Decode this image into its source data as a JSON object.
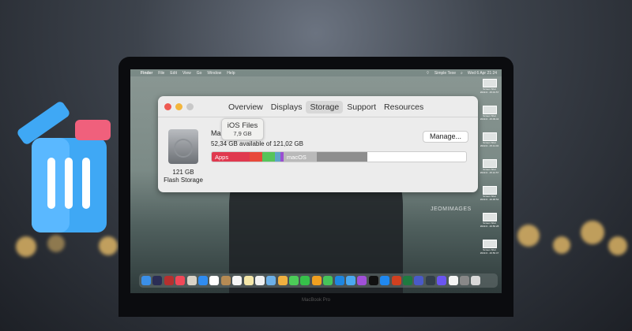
{
  "menubar": {
    "items": [
      "Finder",
      "File",
      "Edit",
      "View",
      "Go",
      "Window",
      "Help"
    ],
    "user": "Simple Texe",
    "clock": "Wed 6 Apr 21:24"
  },
  "window": {
    "tabs": [
      "Overview",
      "Displays",
      "Storage",
      "Support",
      "Resources"
    ],
    "active_tab": "Storage",
    "disk": {
      "size": "121 GB",
      "type": "Flash Storage"
    },
    "volume_name": "Ma",
    "available": "52,34 GB available of 121,02 GB",
    "tooltip": {
      "title": "iOS Files",
      "size": "7,9 GB"
    },
    "manage_label": "Manage...",
    "segments": [
      {
        "label": "Apps",
        "color": "#e0394f",
        "pct": 15
      },
      {
        "label": "",
        "color": "#e8493a",
        "pct": 5
      },
      {
        "label": "",
        "color": "#57c45a",
        "pct": 5
      },
      {
        "label": "",
        "color": "#5fa3c9",
        "pct": 2
      },
      {
        "label": "",
        "color": "#9b4fd1",
        "pct": 1
      },
      {
        "label": "macOS",
        "color": "#b9b9b9",
        "pct": 13
      },
      {
        "label": "",
        "color": "#8e8e8e",
        "pct": 20
      }
    ]
  },
  "desktop_files": [
    {
      "name": "Screen Shot",
      "date": "2022-0...15.01.57"
    },
    {
      "name": "Screen Shot",
      "date": "2022-0...15.09.44"
    },
    {
      "name": "Screen Shot",
      "date": "2022-0...15.11.04"
    },
    {
      "name": "Screen Shot",
      "date": "2022-0...15.12.57"
    },
    {
      "name": "Screen Shot",
      "date": "2022-0...16.48.52"
    },
    {
      "name": "Screen Shot",
      "date": "2022-0...16.50.28"
    },
    {
      "name": "Screen Shot",
      "date": "2022-0...16.50.47"
    }
  ],
  "dock_colors": [
    "#3b8fe8",
    "#2b2d55",
    "#b5302f",
    "#f04858",
    "#d9d2c6",
    "#2f8cf0",
    "#ffffff",
    "#b58b54",
    "#f5f5f5",
    "#f3e6a8",
    "#f1f1f1",
    "#6cb0e8",
    "#f0b040",
    "#4ccc58",
    "#36c04a",
    "#f0a020",
    "#46c45a",
    "#1e86e0",
    "#4aa8f0",
    "#a050d8",
    "#111111",
    "#1f88f0",
    "#d04020",
    "#1f7a40",
    "#4a5ac8",
    "#333f4a",
    "#6a55f0",
    "#f4f4f4",
    "#888888",
    "#d8d8d8"
  ],
  "watermark": "JEOMIMAGES",
  "laptop_label": "MacBook Pro"
}
